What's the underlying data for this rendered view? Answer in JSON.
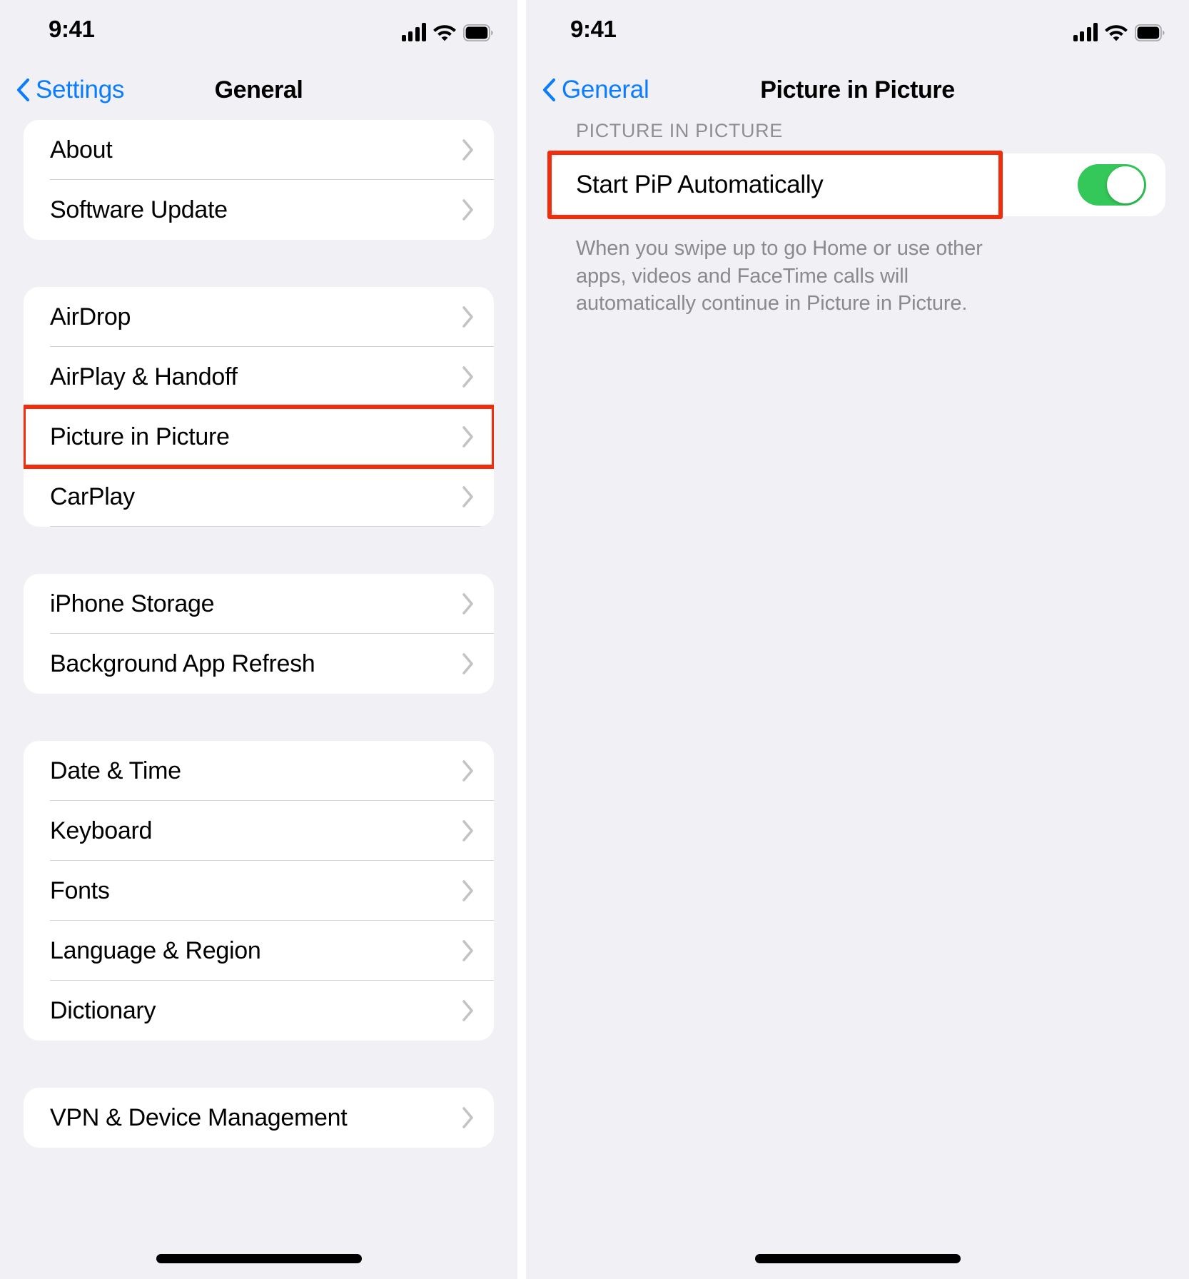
{
  "left_screen": {
    "status_bar": {
      "time": "9:41",
      "cellular_icon": "cellular-bars-icon",
      "wifi_icon": "wifi-icon",
      "battery_icon": "battery-full-icon"
    },
    "nav": {
      "back_label": "Settings",
      "back_icon": "chevron-left-icon",
      "title": "General"
    },
    "groups": [
      {
        "rows": [
          {
            "label": "About",
            "accessory": "chevron-right-icon"
          },
          {
            "label": "Software Update",
            "accessory": "chevron-right-icon"
          }
        ]
      },
      {
        "rows": [
          {
            "label": "AirDrop",
            "accessory": "chevron-right-icon"
          },
          {
            "label": "AirPlay & Handoff",
            "accessory": "chevron-right-icon"
          },
          {
            "label": "Picture in Picture",
            "accessory": "chevron-right-icon",
            "highlighted": true
          },
          {
            "label": "CarPlay",
            "accessory": "chevron-right-icon"
          }
        ]
      },
      {
        "rows": [
          {
            "label": "iPhone Storage",
            "accessory": "chevron-right-icon"
          },
          {
            "label": "Background App Refresh",
            "accessory": "chevron-right-icon"
          }
        ]
      },
      {
        "rows": [
          {
            "label": "Date & Time",
            "accessory": "chevron-right-icon"
          },
          {
            "label": "Keyboard",
            "accessory": "chevron-right-icon"
          },
          {
            "label": "Fonts",
            "accessory": "chevron-right-icon"
          },
          {
            "label": "Language & Region",
            "accessory": "chevron-right-icon"
          },
          {
            "label": "Dictionary",
            "accessory": "chevron-right-icon"
          }
        ]
      },
      {
        "rows": [
          {
            "label": "VPN & Device Management",
            "accessory": "chevron-right-icon"
          }
        ]
      }
    ]
  },
  "right_screen": {
    "status_bar": {
      "time": "9:41",
      "cellular_icon": "cellular-bars-icon",
      "wifi_icon": "wifi-icon",
      "battery_icon": "battery-full-icon"
    },
    "nav": {
      "back_label": "General",
      "back_icon": "chevron-left-icon",
      "title": "Picture in Picture"
    },
    "section_header": "PICTURE IN PICTURE",
    "toggle": {
      "label": "Start PiP Automatically",
      "state": "on",
      "highlighted": true
    },
    "footnote": "When you swipe up to go Home or use other apps, videos and FaceTime calls will automatically continue in Picture in Picture."
  },
  "colors": {
    "accent_blue": "#0a7cff",
    "highlight_red": "#f22d0c",
    "switch_green": "#34c759",
    "page_background": "#f1f1f5",
    "cell_background": "#ffffff",
    "secondary_text": "#8e8e93"
  }
}
